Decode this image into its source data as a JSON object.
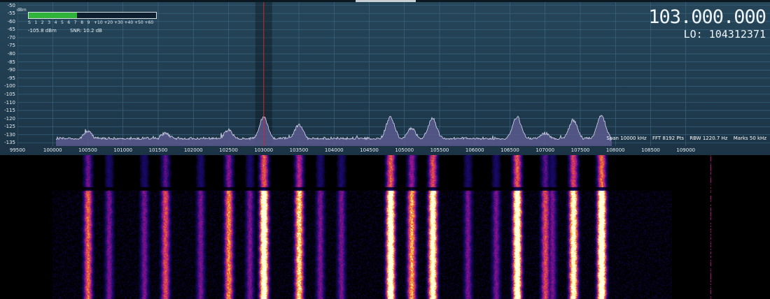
{
  "spectrum": {
    "y_unit": "dBm",
    "y_ticks": [
      "-50",
      "-55",
      "-60",
      "-65",
      "-70",
      "-75",
      "-80",
      "-85",
      "-90",
      "-95",
      "-100",
      "-105",
      "-110",
      "-115",
      "-120",
      "-125",
      "-130",
      "-135"
    ],
    "x_ticks": [
      "99500",
      "100000",
      "100500",
      "101000",
      "101500",
      "102000",
      "102500",
      "103000",
      "103500",
      "104000",
      "104500",
      "105000",
      "105500",
      "106000",
      "106500",
      "107000",
      "107500",
      "108000",
      "108500",
      "109000"
    ],
    "x_tick_values_khz": [
      99500,
      100000,
      100500,
      101000,
      101500,
      102000,
      102500,
      103000,
      103500,
      104000,
      104500,
      105000,
      105500,
      106000,
      106500,
      107000,
      107500,
      108000,
      108500,
      109000
    ],
    "tuned_khz": 103000,
    "noise_floor_dbm": -133,
    "peaks": [
      {
        "khz": 100500,
        "dbm": -128
      },
      {
        "khz": 101600,
        "dbm": -129
      },
      {
        "khz": 102500,
        "dbm": -127
      },
      {
        "khz": 103000,
        "dbm": -119
      },
      {
        "khz": 103500,
        "dbm": -124
      },
      {
        "khz": 104800,
        "dbm": -119
      },
      {
        "khz": 105100,
        "dbm": -126
      },
      {
        "khz": 105400,
        "dbm": -120
      },
      {
        "khz": 106600,
        "dbm": -119
      },
      {
        "khz": 107000,
        "dbm": -129
      },
      {
        "khz": 107400,
        "dbm": -121
      },
      {
        "khz": 107800,
        "dbm": -118
      }
    ]
  },
  "smeter": {
    "scale": [
      "S",
      "1",
      "2",
      "3",
      "4",
      "5",
      "6",
      "7",
      "8",
      "9",
      "+10",
      "+20",
      "+30",
      "+40",
      "+50",
      "+60"
    ],
    "level_fraction": 0.38,
    "level_text": "-105.8 dBm",
    "snr_text": "SNR: 10.2 dB"
  },
  "frequency": {
    "main": "103.000.000",
    "lo": "LO: 104312371"
  },
  "status": {
    "span": "Span 10000 kHz",
    "fft": "FFT 8192 Pts",
    "rbw": "RBW 1220.7 Hz",
    "marks": "Marks 50 kHz"
  },
  "colors": {
    "spectrum_fill": "#5a5b8e",
    "spectrum_line": "#d8d8ee",
    "cursor": "#c8283a",
    "smeter_fill": "#2fb33a"
  }
}
